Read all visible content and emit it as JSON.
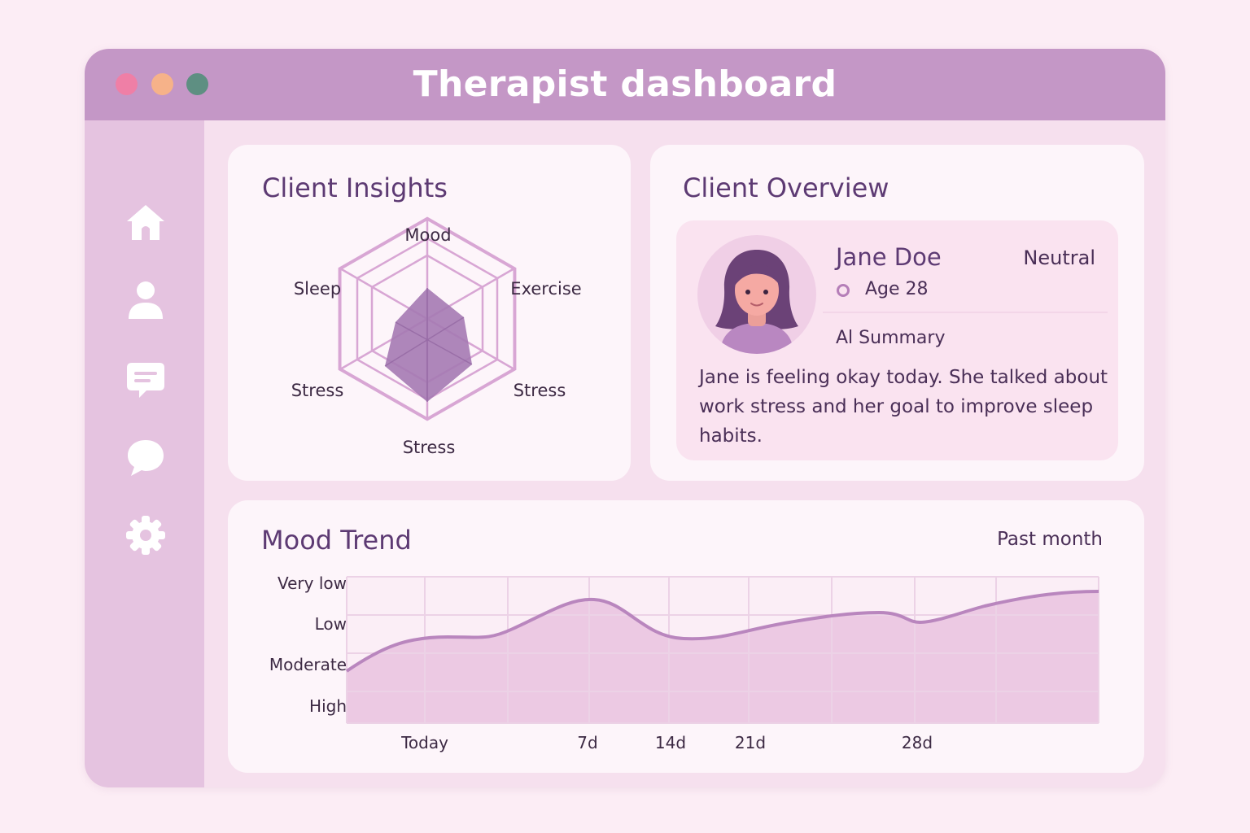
{
  "window": {
    "title": "Therapist dashboard",
    "controls": [
      {
        "name": "close",
        "color": "#ef7fa6"
      },
      {
        "name": "minimize",
        "color": "#f6b289"
      },
      {
        "name": "maximize",
        "color": "#5e8f82"
      }
    ]
  },
  "sidebar": {
    "items": [
      {
        "icon": "home-icon"
      },
      {
        "icon": "user-icon"
      },
      {
        "icon": "message-icon"
      },
      {
        "icon": "chat-bubble-icon"
      },
      {
        "icon": "gear-icon"
      }
    ]
  },
  "insights": {
    "title": "Client Insights",
    "radar": {
      "axes": [
        "Mood",
        "Exercise",
        "Stress",
        "Stress",
        "Stress",
        "Sleep"
      ]
    }
  },
  "overview": {
    "title": "Client Overview",
    "client": {
      "name": "Jane Doe",
      "mood": "Neutral",
      "age": "Age 28"
    },
    "summary_title": "Al Summary",
    "summary": "Jane is feeling okay today. She talked about work stress and her goal to improve sleep habits."
  },
  "mood_trend": {
    "title": "Mood Trend",
    "range": "Past month",
    "y_labels": [
      "Very low",
      "Low",
      "Moderate",
      "High"
    ],
    "x_labels": [
      "Today",
      "7d",
      "14d",
      "21d",
      "28d"
    ]
  },
  "colors": {
    "accent": "#c497c6",
    "sidebar": "#e5c3e0",
    "radar_fill": "#a57ab3",
    "line": "#b986be",
    "area": "#ecc9e3"
  }
}
